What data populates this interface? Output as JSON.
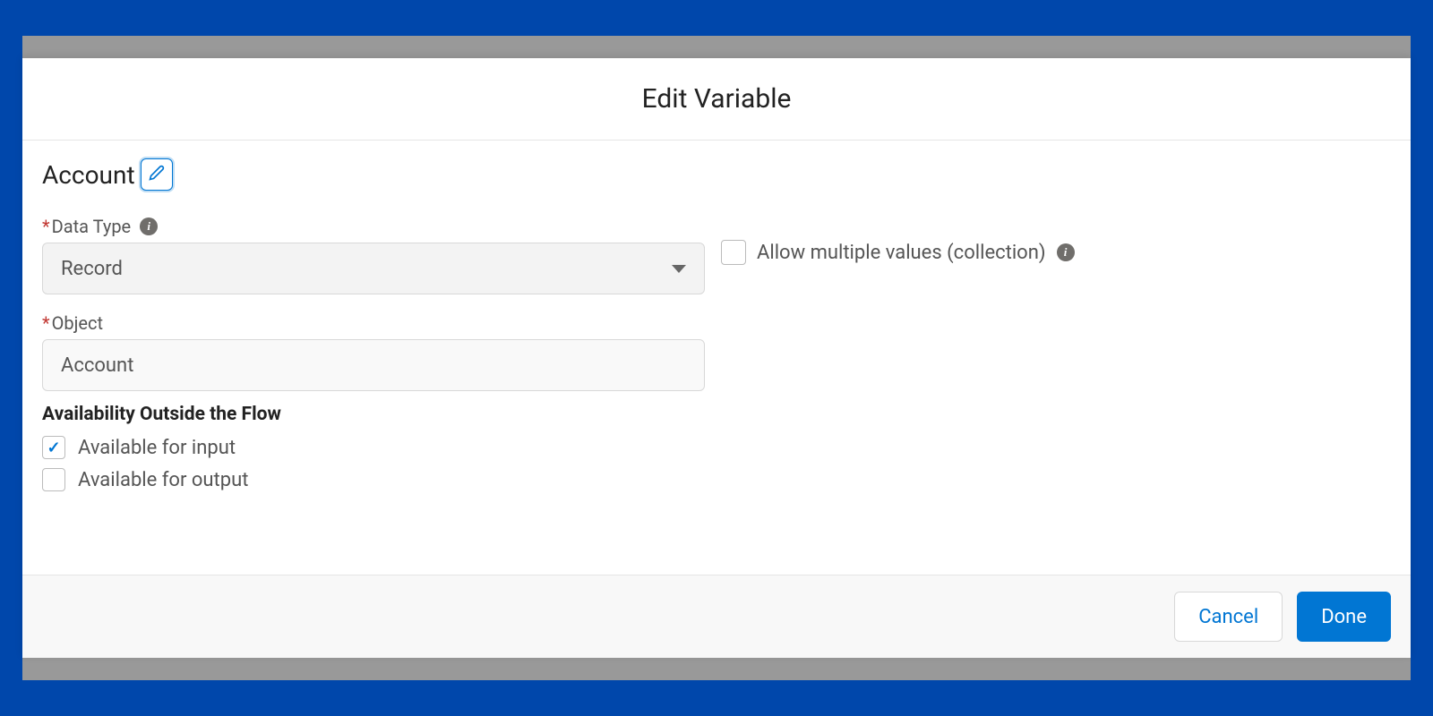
{
  "modal": {
    "title": "Edit Variable"
  },
  "variable": {
    "name": "Account"
  },
  "fields": {
    "dataType": {
      "label": "Data Type",
      "value": "Record"
    },
    "allowMultiple": {
      "label": "Allow multiple values (collection)",
      "checked": false
    },
    "object": {
      "label": "Object",
      "value": "Account"
    }
  },
  "availability": {
    "heading": "Availability Outside the Flow",
    "input": {
      "label": "Available for input",
      "checked": true
    },
    "output": {
      "label": "Available for output",
      "checked": false
    }
  },
  "footer": {
    "cancel": "Cancel",
    "done": "Done"
  }
}
